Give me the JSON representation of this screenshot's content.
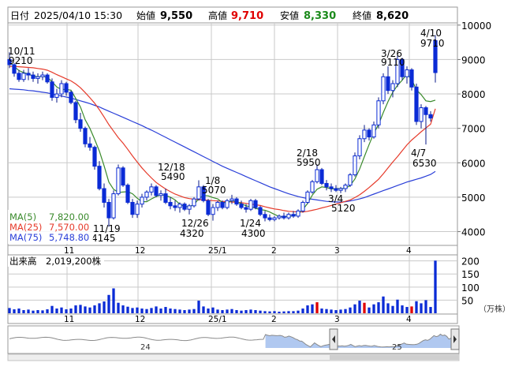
{
  "header": {
    "date_label": "日付",
    "date": "2025/04/10 15:30",
    "open_label": "始値",
    "open": "9,550",
    "high_label": "高値",
    "high": "9,710",
    "low_label": "安値",
    "low": "8,330",
    "close_label": "終値",
    "close": "8,620"
  },
  "colors": {
    "up": "#0a2bd6",
    "down": "#0a2bd6",
    "ma5": "#3a8a2c",
    "ma25": "#e63a2a",
    "ma75": "#2a3fd8",
    "high": "#e00000",
    "low": "#1c8a1c",
    "grid": "#c9c9c9",
    "volume": "#0a2bd6",
    "volume_red": "#e00000",
    "nav_fill": "#8fb1ea"
  },
  "main_chart": {
    "y_ticks": [
      "10000",
      "9000",
      "8000",
      "7000",
      "6000",
      "5000",
      "4000"
    ],
    "x_ticks": [
      "11",
      "12",
      "25/1",
      "2",
      "3",
      "4"
    ],
    "legend": [
      {
        "label": "MA(5)",
        "value": "7,820.00"
      },
      {
        "label": "MA(25)",
        "value": "7,570.00"
      },
      {
        "label": "MA(75)",
        "value": "5,748.80"
      }
    ],
    "annotations": [
      {
        "date": "10/11",
        "price": "9210"
      },
      {
        "date": "12/18",
        "price": "5490"
      },
      {
        "date": "1/8",
        "price": "5070"
      },
      {
        "date": "2/18",
        "price": "5950"
      },
      {
        "date": "3/26",
        "price": "9110"
      },
      {
        "date": "4/10",
        "price": "9710"
      },
      {
        "date": "11/19",
        "price": "4145"
      },
      {
        "date": "12/26",
        "price": "4320"
      },
      {
        "date": "1/24",
        "price": "4300"
      },
      {
        "date": "3/4",
        "price": "5120"
      },
      {
        "date": "4/7",
        "price": "6530"
      }
    ]
  },
  "volume_chart": {
    "title": "出来高",
    "value": "2,019,200株",
    "y_ticks": [
      "200",
      "150",
      "100",
      "50"
    ],
    "unit": "（万株）",
    "x_ticks": [
      "11",
      "12",
      "25/1",
      "2",
      "3",
      "4"
    ]
  },
  "navigator": {
    "labels": [
      "24",
      "25"
    ]
  },
  "chart_data": {
    "type": "candlestick",
    "ylim": [
      3600,
      10500
    ],
    "candles": [
      {
        "o": 9000,
        "h": 9210,
        "l": 8750,
        "c": 8850
      },
      {
        "o": 8850,
        "h": 8900,
        "l": 8500,
        "c": 8600
      },
      {
        "o": 8600,
        "h": 8700,
        "l": 8350,
        "c": 8420
      },
      {
        "o": 8420,
        "h": 8700,
        "l": 8350,
        "c": 8600
      },
      {
        "o": 8600,
        "h": 8750,
        "l": 8400,
        "c": 8550
      },
      {
        "o": 8550,
        "h": 8650,
        "l": 8350,
        "c": 8450
      },
      {
        "o": 8450,
        "h": 8600,
        "l": 8300,
        "c": 8500
      },
      {
        "o": 8500,
        "h": 8650,
        "l": 8400,
        "c": 8550
      },
      {
        "o": 8550,
        "h": 8600,
        "l": 8300,
        "c": 8350
      },
      {
        "o": 8350,
        "h": 8450,
        "l": 7800,
        "c": 7900
      },
      {
        "o": 7900,
        "h": 8150,
        "l": 7750,
        "c": 8000
      },
      {
        "o": 8000,
        "h": 8400,
        "l": 7900,
        "c": 8300
      },
      {
        "o": 8300,
        "h": 8350,
        "l": 7950,
        "c": 8050
      },
      {
        "o": 8050,
        "h": 8100,
        "l": 7700,
        "c": 7750
      },
      {
        "o": 7750,
        "h": 7800,
        "l": 7150,
        "c": 7250
      },
      {
        "o": 7250,
        "h": 7450,
        "l": 6900,
        "c": 7000
      },
      {
        "o": 7000,
        "h": 7050,
        "l": 6450,
        "c": 6550
      },
      {
        "o": 6550,
        "h": 6750,
        "l": 6350,
        "c": 6450
      },
      {
        "o": 6450,
        "h": 6500,
        "l": 5800,
        "c": 5900
      },
      {
        "o": 5900,
        "h": 6050,
        "l": 5200,
        "c": 5250
      },
      {
        "o": 5250,
        "h": 5400,
        "l": 4700,
        "c": 4850
      },
      {
        "o": 4850,
        "h": 4950,
        "l": 4145,
        "c": 4400
      },
      {
        "o": 4400,
        "h": 5200,
        "l": 4350,
        "c": 5100
      },
      {
        "o": 5100,
        "h": 5950,
        "l": 5050,
        "c": 5850
      },
      {
        "o": 5850,
        "h": 5900,
        "l": 5300,
        "c": 5350
      },
      {
        "o": 5350,
        "h": 5400,
        "l": 4800,
        "c": 4850
      },
      {
        "o": 4850,
        "h": 4950,
        "l": 4400,
        "c": 4500
      },
      {
        "o": 4500,
        "h": 4900,
        "l": 4400,
        "c": 4800
      },
      {
        "o": 4800,
        "h": 5100,
        "l": 4700,
        "c": 5000
      },
      {
        "o": 5000,
        "h": 5200,
        "l": 4900,
        "c": 5150
      },
      {
        "o": 5150,
        "h": 5400,
        "l": 5050,
        "c": 5300
      },
      {
        "o": 5300,
        "h": 5350,
        "l": 5000,
        "c": 5050
      },
      {
        "o": 5050,
        "h": 5200,
        "l": 4900,
        "c": 5100
      },
      {
        "o": 5100,
        "h": 5250,
        "l": 4800,
        "c": 4850
      },
      {
        "o": 4850,
        "h": 5000,
        "l": 4650,
        "c": 4750
      },
      {
        "o": 4750,
        "h": 4900,
        "l": 4600,
        "c": 4700
      },
      {
        "o": 4700,
        "h": 4850,
        "l": 4550,
        "c": 4800
      },
      {
        "o": 4800,
        "h": 4850,
        "l": 4600,
        "c": 4650
      },
      {
        "o": 4650,
        "h": 4800,
        "l": 4500,
        "c": 4750
      },
      {
        "o": 4750,
        "h": 5000,
        "l": 4700,
        "c": 4950
      },
      {
        "o": 4950,
        "h": 5490,
        "l": 4900,
        "c": 5300
      },
      {
        "o": 5300,
        "h": 5350,
        "l": 4850,
        "c": 4900
      },
      {
        "o": 4900,
        "h": 4950,
        "l": 4450,
        "c": 4500
      },
      {
        "o": 4500,
        "h": 4800,
        "l": 4320,
        "c": 4700
      },
      {
        "o": 4700,
        "h": 4900,
        "l": 4600,
        "c": 4850
      },
      {
        "o": 4850,
        "h": 4900,
        "l": 4650,
        "c": 4700
      },
      {
        "o": 4700,
        "h": 4950,
        "l": 4650,
        "c": 4900
      },
      {
        "o": 4900,
        "h": 5070,
        "l": 4800,
        "c": 4950
      },
      {
        "o": 4950,
        "h": 5000,
        "l": 4750,
        "c": 4800
      },
      {
        "o": 4800,
        "h": 4900,
        "l": 4650,
        "c": 4700
      },
      {
        "o": 4700,
        "h": 4800,
        "l": 4550,
        "c": 4650
      },
      {
        "o": 4650,
        "h": 4950,
        "l": 4600,
        "c": 4900
      },
      {
        "o": 4900,
        "h": 4950,
        "l": 4650,
        "c": 4700
      },
      {
        "o": 4700,
        "h": 4750,
        "l": 4450,
        "c": 4500
      },
      {
        "o": 4500,
        "h": 4600,
        "l": 4300,
        "c": 4400
      },
      {
        "o": 4400,
        "h": 4500,
        "l": 4300,
        "c": 4350
      },
      {
        "o": 4350,
        "h": 4450,
        "l": 4300,
        "c": 4400
      },
      {
        "o": 4400,
        "h": 4500,
        "l": 4350,
        "c": 4450
      },
      {
        "o": 4450,
        "h": 4550,
        "l": 4350,
        "c": 4400
      },
      {
        "o": 4400,
        "h": 4550,
        "l": 4350,
        "c": 4500
      },
      {
        "o": 4500,
        "h": 4600,
        "l": 4400,
        "c": 4450
      },
      {
        "o": 4450,
        "h": 4650,
        "l": 4400,
        "c": 4600
      },
      {
        "o": 4600,
        "h": 4900,
        "l": 4550,
        "c": 4850
      },
      {
        "o": 4850,
        "h": 5200,
        "l": 4800,
        "c": 5150
      },
      {
        "o": 5150,
        "h": 5500,
        "l": 5100,
        "c": 5450
      },
      {
        "o": 5450,
        "h": 5950,
        "l": 5400,
        "c": 5800
      },
      {
        "o": 5800,
        "h": 5850,
        "l": 5350,
        "c": 5400
      },
      {
        "o": 5400,
        "h": 5500,
        "l": 5200,
        "c": 5300
      },
      {
        "o": 5300,
        "h": 5400,
        "l": 5150,
        "c": 5250
      },
      {
        "o": 5250,
        "h": 5350,
        "l": 5150,
        "c": 5200
      },
      {
        "o": 5200,
        "h": 5300,
        "l": 5120,
        "c": 5250
      },
      {
        "o": 5250,
        "h": 5400,
        "l": 5150,
        "c": 5350
      },
      {
        "o": 5350,
        "h": 5700,
        "l": 5300,
        "c": 5650
      },
      {
        "o": 5650,
        "h": 6300,
        "l": 5600,
        "c": 6200
      },
      {
        "o": 6200,
        "h": 6800,
        "l": 6100,
        "c": 6700
      },
      {
        "o": 6700,
        "h": 7100,
        "l": 6600,
        "c": 6950
      },
      {
        "o": 6950,
        "h": 7000,
        "l": 6650,
        "c": 6750
      },
      {
        "o": 6750,
        "h": 7200,
        "l": 6700,
        "c": 7100
      },
      {
        "o": 7100,
        "h": 7900,
        "l": 7000,
        "c": 7800
      },
      {
        "o": 7800,
        "h": 8600,
        "l": 7700,
        "c": 8500
      },
      {
        "o": 8500,
        "h": 8800,
        "l": 8000,
        "c": 8100
      },
      {
        "o": 8100,
        "h": 8400,
        "l": 7900,
        "c": 8300
      },
      {
        "o": 8300,
        "h": 9110,
        "l": 8200,
        "c": 9000
      },
      {
        "o": 9000,
        "h": 9050,
        "l": 8400,
        "c": 8500
      },
      {
        "o": 8500,
        "h": 8800,
        "l": 8300,
        "c": 8700
      },
      {
        "o": 8700,
        "h": 8750,
        "l": 8100,
        "c": 8200
      },
      {
        "o": 8200,
        "h": 8300,
        "l": 7100,
        "c": 7200
      },
      {
        "o": 7200,
        "h": 7700,
        "l": 7000,
        "c": 7600
      },
      {
        "o": 7600,
        "h": 7650,
        "l": 6530,
        "c": 7400
      },
      {
        "o": 7400,
        "h": 7500,
        "l": 7200,
        "c": 7300
      },
      {
        "o": 9550,
        "h": 9710,
        "l": 8330,
        "c": 8620
      }
    ],
    "ma5": [
      8950,
      8800,
      8680,
      8620,
      8580,
      8520,
      8500,
      8510,
      8480,
      8360,
      8200,
      8130,
      8130,
      8110,
      7870,
      7620,
      7250,
      7000,
      6680,
      6340,
      5910,
      5440,
      5230,
      5140,
      5150,
      5160,
      5100,
      4970,
      4870,
      4870,
      4950,
      5020,
      5070,
      5050,
      5000,
      4920,
      4800,
      4720,
      4730,
      4780,
      4960,
      5050,
      5040,
      4990,
      4950,
      4850,
      4840,
      4900,
      4870,
      4810,
      4750,
      4720,
      4680,
      4640,
      4620,
      4570,
      4500,
      4440,
      4430,
      4450,
      4460,
      4520,
      4640,
      4820,
      5060,
      5230,
      5300,
      5280,
      5240,
      5250,
      5250,
      5260,
      5340,
      5530,
      5820,
      6180,
      6530,
      6860,
      7110,
      7460,
      7780,
      8050,
      8250,
      8400,
      8580,
      8420,
      8120,
      7980,
      7800,
      7780,
      7820
    ],
    "ma25": [
      8800,
      8800,
      8790,
      8780,
      8770,
      8760,
      8740,
      8720,
      8690,
      8630,
      8560,
      8500,
      8440,
      8380,
      8290,
      8180,
      8040,
      7890,
      7730,
      7540,
      7330,
      7110,
      6920,
      6730,
      6570,
      6390,
      6200,
      6020,
      5850,
      5700,
      5560,
      5430,
      5330,
      5240,
      5160,
      5090,
      5040,
      4990,
      4960,
      4940,
      4930,
      4920,
      4910,
      4900,
      4890,
      4880,
      4870,
      4860,
      4850,
      4840,
      4820,
      4800,
      4780,
      4760,
      4720,
      4690,
      4660,
      4640,
      4610,
      4590,
      4580,
      4570,
      4570,
      4590,
      4620,
      4650,
      4690,
      4720,
      4760,
      4800,
      4840,
      4880,
      4920,
      4990,
      5070,
      5170,
      5280,
      5400,
      5520,
      5680,
      5850,
      6020,
      6180,
      6350,
      6520,
      6660,
      6780,
      6900,
      7010,
      7120,
      7570
    ],
    "ma75": [
      8150,
      8140,
      8130,
      8120,
      8100,
      8090,
      8070,
      8050,
      8030,
      8000,
      7970,
      7940,
      7910,
      7880,
      7840,
      7800,
      7760,
      7720,
      7670,
      7620,
      7560,
      7500,
      7440,
      7380,
      7320,
      7260,
      7200,
      7140,
      7080,
      7010,
      6950,
      6880,
      6810,
      6740,
      6670,
      6600,
      6530,
      6460,
      6390,
      6320,
      6250,
      6180,
      6110,
      6040,
      5970,
      5900,
      5840,
      5780,
      5720,
      5660,
      5600,
      5540,
      5480,
      5420,
      5360,
      5300,
      5250,
      5200,
      5150,
      5100,
      5060,
      5020,
      4990,
      4960,
      4940,
      4920,
      4900,
      4880,
      4870,
      4860,
      4860,
      4870,
      4890,
      4920,
      4950,
      4990,
      5040,
      5090,
      5140,
      5190,
      5240,
      5290,
      5340,
      5390,
      5440,
      5480,
      5520,
      5560,
      5610,
      5660,
      5750
    ],
    "volume": [
      20,
      15,
      18,
      12,
      14,
      10,
      12,
      11,
      15,
      28,
      18,
      22,
      15,
      18,
      30,
      32,
      26,
      22,
      30,
      38,
      45,
      70,
      95,
      40,
      30,
      25,
      20,
      22,
      18,
      16,
      20,
      26,
      18,
      24,
      18,
      16,
      14,
      12,
      14,
      16,
      48,
      26,
      18,
      22,
      14,
      12,
      14,
      16,
      12,
      10,
      12,
      14,
      12,
      10,
      8,
      7,
      8,
      6,
      7,
      8,
      8,
      10,
      18,
      30,
      34,
      42,
      18,
      16,
      14,
      12,
      14,
      16,
      22,
      34,
      48,
      40,
      22,
      34,
      42,
      64,
      38,
      28,
      52,
      30,
      24,
      26,
      46,
      38,
      50,
      24,
      201
    ],
    "volume_red": [
      false,
      false,
      false,
      false,
      false,
      false,
      false,
      false,
      false,
      false,
      false,
      false,
      false,
      false,
      false,
      false,
      false,
      false,
      false,
      false,
      false,
      false,
      false,
      false,
      false,
      false,
      false,
      false,
      false,
      false,
      false,
      false,
      false,
      false,
      false,
      false,
      false,
      false,
      false,
      false,
      false,
      false,
      false,
      false,
      false,
      false,
      false,
      false,
      false,
      false,
      false,
      false,
      false,
      false,
      false,
      false,
      false,
      false,
      false,
      false,
      false,
      false,
      false,
      false,
      false,
      true,
      false,
      false,
      false,
      false,
      false,
      false,
      false,
      false,
      false,
      true,
      false,
      false,
      false,
      false,
      false,
      false,
      false,
      false,
      false,
      true,
      false,
      false,
      false,
      false,
      false
    ]
  }
}
